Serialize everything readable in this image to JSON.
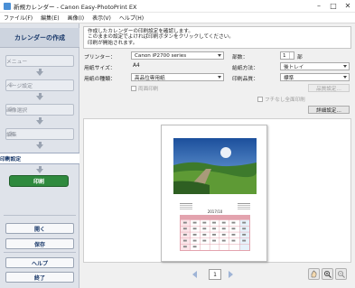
{
  "window": {
    "title": "新規カレンダー - Canon Easy-PhotoPrint EX"
  },
  "menu": [
    "ファイル(F)",
    "編集(E)",
    "画像(I)",
    "表示(V)",
    "ヘルプ(H)"
  ],
  "sidebar": {
    "title": "カレンダーの作成",
    "steps": [
      {
        "num": "",
        "label": "メニュー"
      },
      {
        "num": "①",
        "label": "ページ設定"
      },
      {
        "num": "②",
        "label": "画像選択"
      },
      {
        "num": "③",
        "label": "編集"
      }
    ],
    "active_step": {
      "num": "④",
      "label": "印刷設定"
    },
    "print_button": "印刷",
    "buttons": {
      "open": "開く",
      "save": "保存",
      "help": "ヘルプ",
      "exit": "終了"
    }
  },
  "info": {
    "lines": [
      "作成したカレンダーの印刷設定を確認します。",
      "このままの設定でよければ印刷ボタンをクリックしてください。",
      "印刷が開始されます。"
    ]
  },
  "settings": {
    "printer_label": "プリンター：",
    "printer_value": "Canon iP2700 series",
    "paper_size_label": "用紙サイズ：",
    "paper_size_value": "A4",
    "media_label": "用紙の種類：",
    "media_value": "高品位専用紙",
    "duplex_label": "両面印刷",
    "copies_label": "部数：",
    "copies_value": "1",
    "copies_unit": "部",
    "feed_label": "給紙方法：",
    "feed_value": "後トレイ",
    "quality_label": "印刷品質：",
    "quality_value": "標準",
    "quality_settings_button": "品質設定...",
    "borderless_label": "フチなし全面印刷",
    "advanced_button": "詳細設定..."
  },
  "preview": {
    "calendar_title": "2017/10",
    "page_number": "1"
  },
  "colors": {
    "sidebar_bg": "#dfe3ea",
    "print_button": "#2f8a3e",
    "accent_navy": "#1b3a6b",
    "calendar_pink": "#e3a3ae"
  }
}
